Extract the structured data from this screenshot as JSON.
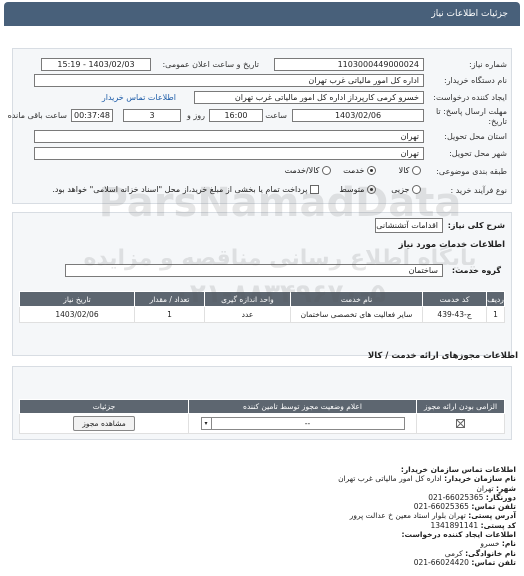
{
  "header": {
    "title": "جزئیات اطلاعات نیاز"
  },
  "form": {
    "need_number_label": "شماره نیاز:",
    "need_number": "1103000449000024",
    "announce_label": "تاریخ و ساعت اعلان عمومی:",
    "announce_value": "1403/02/03 - 15:19",
    "buyer_label": "نام دستگاه خریدار:",
    "buyer_value": "اداره کل امور مالیاتی غرب تهران",
    "creator_label": "ایجاد کننده درخواست:",
    "creator_value": "خسرو کرمی کارپرداز اداره کل امور مالیاتی غرب تهران",
    "buyer_contact_link": "اطلاعات تماس خریدار",
    "deadline_label": "مهلت ارسال پاسخ: تا",
    "deadline_label2": "تاریخ:",
    "deadline_date": "1403/02/06",
    "time_label": "ساعت",
    "deadline_time": "16:00",
    "days_value": "3",
    "days_label": "روز و",
    "remaining_time": "00:37:48",
    "remaining_label": "ساعت باقی مانده",
    "province_label": "استان محل تحویل:",
    "province_value": "تهران",
    "city_label": "شهر محل تحویل:",
    "city_value": "تهران",
    "category_label": "طبقه بندی موضوعی:",
    "category_options": [
      "کالا",
      "خدمت",
      "کالا/خدمت"
    ],
    "process_label": "نوع فرآیند خرید :",
    "process_options": [
      "جزیی",
      "متوسط"
    ],
    "payment_note": "پرداخت تمام یا بخشی از مبلغ خرید،از محل \"اسناد خزانه اسلامی\" خواهد بود."
  },
  "summary": {
    "label": "شرح کلی نیاز:",
    "value": "اقدامات آتشنشانی"
  },
  "services": {
    "section_title": "اطلاعات خدمات مورد نیاز",
    "group_label": "گروه خدمت:",
    "group_value": "ساختمان",
    "columns": [
      "ردیف",
      "کد خدمت",
      "نام خدمت",
      "واحد اندازه گیری",
      "تعداد / مقدار",
      "تاریخ نیاز"
    ],
    "rows": [
      {
        "row": "1",
        "code": "ج-43-439",
        "name": "سایر فعالیت های تخصصی ساختمان",
        "unit": "عدد",
        "qty": "1",
        "date": "1403/02/06"
      }
    ]
  },
  "permits": {
    "section_title": "اطلاعات مجوزهای ارائه خدمت / کالا",
    "columns": [
      "الزامی بودن ارائه مجوز",
      "اعلام وضعیت مجوز توسط تامین کننده",
      "جزئیات"
    ],
    "select_value": "--",
    "view_button": "مشاهده مجوز"
  },
  "contact": {
    "title": "اطلاعات تماس سازمان خریدار:",
    "org_label": "نام سازمان خریدار:",
    "org_value": "اداره کل امور مالیاتی غرب تهران",
    "city_label": "شهر:",
    "city_value": "تهران",
    "fax_label": "دورنگار:",
    "fax_value": "66025365-021",
    "phone_label": "تلفن تماس:",
    "phone_value": "66025365-021",
    "address_label": "آدرس پستی:",
    "address_value": "تهران بلوار استاد معین خ عدالت پرور",
    "postal_label": "کد پستی:",
    "postal_value": "1341891141",
    "creator_title": "اطلاعات ایجاد کننده درخواست:",
    "name_label": "نام:",
    "name_value": "خسرو",
    "family_label": "نام خانوادگی:",
    "family_value": "کرمی",
    "creator_phone_label": "تلفن تماس:",
    "creator_phone_value": "66024420-021"
  },
  "watermark": {
    "line1": "ParsNamadData",
    "line2": "پایگاه اطلاع رسانی مناقصه و مزایده",
    "line3": "۰۲۱-۸۸۳۴۹۶۷۰-۵"
  }
}
